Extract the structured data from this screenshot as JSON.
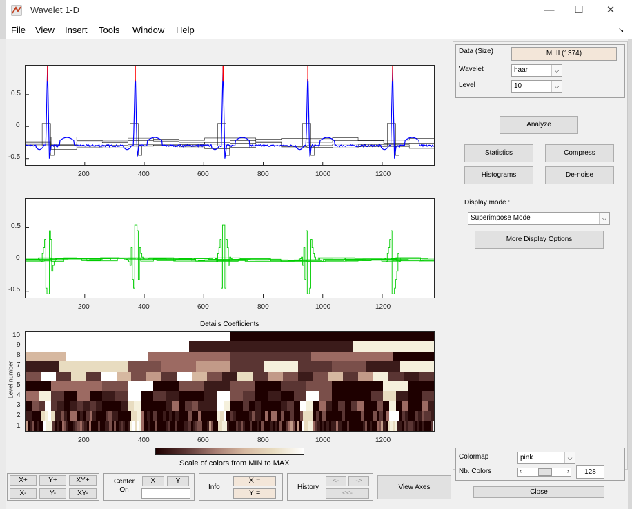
{
  "window": {
    "title": "Wavelet 1-D",
    "minimize": "—",
    "maximize": "☐",
    "close": "✕"
  },
  "menu": [
    "File",
    "View",
    "Insert",
    "Tools",
    "Window",
    "Help"
  ],
  "plot1": {
    "y_ticks": [
      "0.5",
      "0",
      "-0.5"
    ],
    "x_ticks": [
      "200",
      "400",
      "600",
      "800",
      "1000",
      "1200"
    ]
  },
  "plot2": {
    "y_ticks": [
      "0.5",
      "0",
      "-0.5"
    ],
    "x_ticks": [
      "200",
      "400",
      "600",
      "800",
      "1000",
      "1200"
    ]
  },
  "plot3": {
    "title": "Details Coefficients",
    "y_label": "Level number",
    "y_ticks": [
      "10",
      "9",
      "8",
      "7",
      "6",
      "5",
      "4",
      "3",
      "2",
      "1"
    ],
    "x_ticks": [
      "200",
      "400",
      "600",
      "800",
      "1000",
      "1200"
    ]
  },
  "colorbar_label": "Scale of colors from MIN to MAX",
  "panel": {
    "data_label": "Data  (Size)",
    "data_value": "MLII  (1374)",
    "wavelet_label": "Wavelet",
    "wavelet_value": "haar",
    "level_label": "Level",
    "level_value": "10",
    "analyze": "Analyze",
    "statistics": "Statistics",
    "compress": "Compress",
    "histograms": "Histograms",
    "denoise": "De-noise",
    "display_mode_label": "Display mode :",
    "display_mode_value": "Superimpose Mode",
    "more_display": "More Display Options",
    "colormap_label": "Colormap",
    "colormap_value": "pink",
    "nbcolors_label": "Nb. Colors",
    "nbcolors_value": "128",
    "nbcolors_fraction": 0.5,
    "close": "Close"
  },
  "toolbar": {
    "xplus": "X+",
    "yplus": "Y+",
    "xyplus": "XY+",
    "xminus": "X-",
    "yminus": "Y-",
    "xyminus": "XY-",
    "center_on": "Center On",
    "center_x": "X",
    "center_y": "Y",
    "info": "Info",
    "info_x": "X =",
    "info_y": "Y =",
    "history": "History",
    "hist_back": "<-",
    "hist_fwd": "->",
    "hist_reset": "<<-",
    "view_axes": "View Axes"
  },
  "colors": {
    "signal": "#0000ff",
    "signal_peak": "#ff0000",
    "details": "#00cc00",
    "approx_line": "#1a1a1a",
    "frame_bg": "#f0f0f0",
    "readout_bg": "#f3e6d9"
  },
  "chart_data": [
    {
      "type": "line",
      "title": "",
      "xlim": [
        1,
        1374
      ],
      "ylim": [
        -0.6,
        0.95
      ],
      "series": [
        {
          "values": "ECG signal (MLII) with approximations",
          "peaks_x": [
            75,
            370,
            665,
            950,
            1235
          ]
        }
      ]
    },
    {
      "type": "line",
      "title": "",
      "xlim": [
        1,
        1374
      ],
      "ylim": [
        -0.6,
        0.95
      ],
      "series": [
        {
          "values": "detail coefficients superimposed",
          "peaks_x": [
            75,
            370,
            665,
            950,
            1235
          ]
        }
      ]
    },
    {
      "type": "heatmap",
      "title": "Details Coefficients",
      "xlim": [
        1,
        1374
      ],
      "levels": [
        1,
        2,
        3,
        4,
        5,
        6,
        7,
        8,
        9,
        10
      ],
      "colormap": "pink"
    }
  ]
}
